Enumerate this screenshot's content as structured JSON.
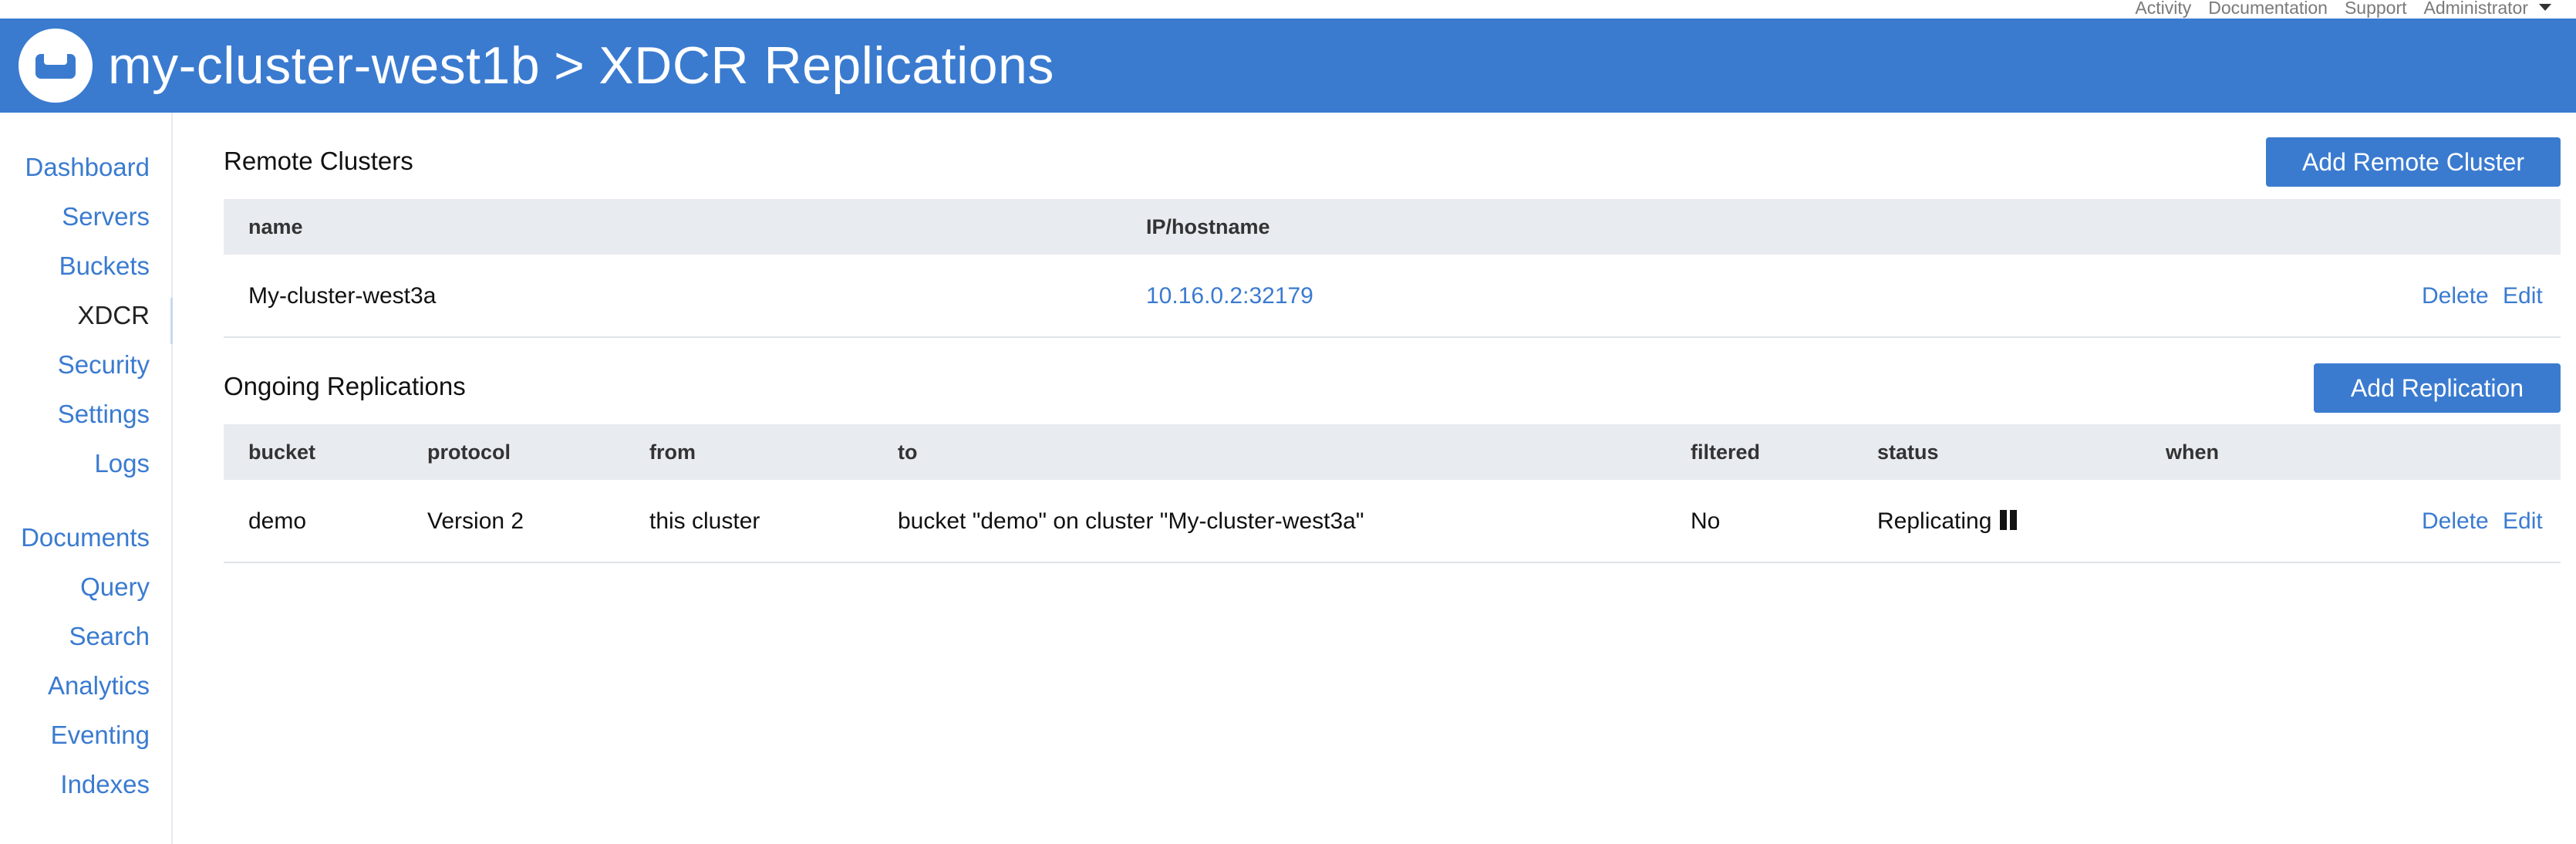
{
  "topnav": {
    "activity": "Activity",
    "documentation": "Documentation",
    "support": "Support",
    "user": "Administrator"
  },
  "header": {
    "cluster": "my-cluster-west1b",
    "separator": ">",
    "page": "XDCR Replications"
  },
  "sidebar": {
    "items": [
      {
        "label": "Dashboard",
        "active": false
      },
      {
        "label": "Servers",
        "active": false
      },
      {
        "label": "Buckets",
        "active": false
      },
      {
        "label": "XDCR",
        "active": true
      },
      {
        "label": "Security",
        "active": false
      },
      {
        "label": "Settings",
        "active": false
      },
      {
        "label": "Logs",
        "active": false
      },
      {
        "label": "Documents",
        "active": false
      },
      {
        "label": "Query",
        "active": false
      },
      {
        "label": "Search",
        "active": false
      },
      {
        "label": "Analytics",
        "active": false
      },
      {
        "label": "Eventing",
        "active": false
      },
      {
        "label": "Indexes",
        "active": false
      }
    ]
  },
  "remote_clusters": {
    "title": "Remote Clusters",
    "add_button": "Add Remote Cluster",
    "columns": {
      "name": "name",
      "host": "IP/hostname"
    },
    "rows": [
      {
        "name": "My-cluster-west3a",
        "host": "10.16.0.2:32179",
        "delete": "Delete",
        "edit": "Edit"
      }
    ]
  },
  "replications": {
    "title": "Ongoing Replications",
    "add_button": "Add Replication",
    "columns": {
      "bucket": "bucket",
      "protocol": "protocol",
      "from": "from",
      "to": "to",
      "filtered": "filtered",
      "status": "status",
      "when": "when"
    },
    "rows": [
      {
        "bucket": "demo",
        "protocol": "Version 2",
        "from": "this cluster",
        "to": "bucket \"demo\" on cluster \"My-cluster-west3a\"",
        "filtered": "No",
        "status": "Replicating",
        "when": "",
        "delete": "Delete",
        "edit": "Edit"
      }
    ]
  },
  "colors": {
    "brand": "#3a7bd0",
    "table_header_bg": "#e8ebef",
    "link": "#3a7bd0"
  },
  "icons": {
    "logo": "couchbase-logo-icon",
    "user_menu": "caret-down-icon",
    "status": "pause-icon"
  }
}
